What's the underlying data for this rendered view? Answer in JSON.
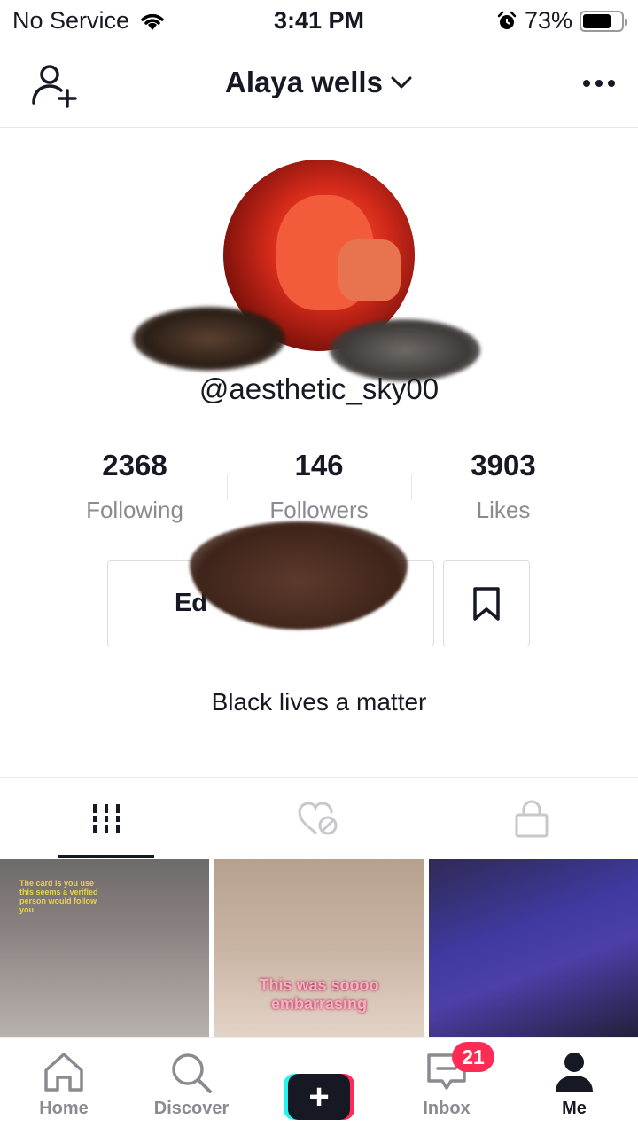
{
  "status_bar": {
    "carrier": "No Service",
    "time": "3:41 PM",
    "battery_percent": "73%",
    "battery_level": 0.73
  },
  "header": {
    "account_name": "Alaya wells",
    "icons": [
      "add-user-icon",
      "chevron-down-icon",
      "more-icon"
    ]
  },
  "profile": {
    "username": "@aesthetic_sky00",
    "stats": [
      {
        "value": "2368",
        "label": "Following"
      },
      {
        "value": "146",
        "label": "Followers"
      },
      {
        "value": "3903",
        "label": "Likes"
      }
    ],
    "edit_label": "Ed",
    "bio": "Black lives a matter"
  },
  "tabs": [
    {
      "icon": "videos-grid-icon",
      "active": true
    },
    {
      "icon": "liked-hidden-icon",
      "active": false
    },
    {
      "icon": "private-lock-icon",
      "active": false
    }
  ],
  "videos": [
    {
      "caption": "The card is you use this seems a verified person would follow you"
    },
    {
      "caption": "This was soooo embarrasing"
    },
    {
      "caption": ""
    }
  ],
  "bottom_nav": {
    "items": [
      {
        "label": "Home",
        "icon": "home-icon"
      },
      {
        "label": "Discover",
        "icon": "search-icon"
      },
      {
        "label": "",
        "icon": "plus-icon"
      },
      {
        "label": "Inbox",
        "icon": "inbox-icon",
        "badge": "21"
      },
      {
        "label": "Me",
        "icon": "profile-icon"
      }
    ]
  },
  "colors": {
    "accent_red": "#fe2c55",
    "accent_cyan": "#25f4ee",
    "text_primary": "#161823",
    "text_secondary": "#8a8b91"
  }
}
